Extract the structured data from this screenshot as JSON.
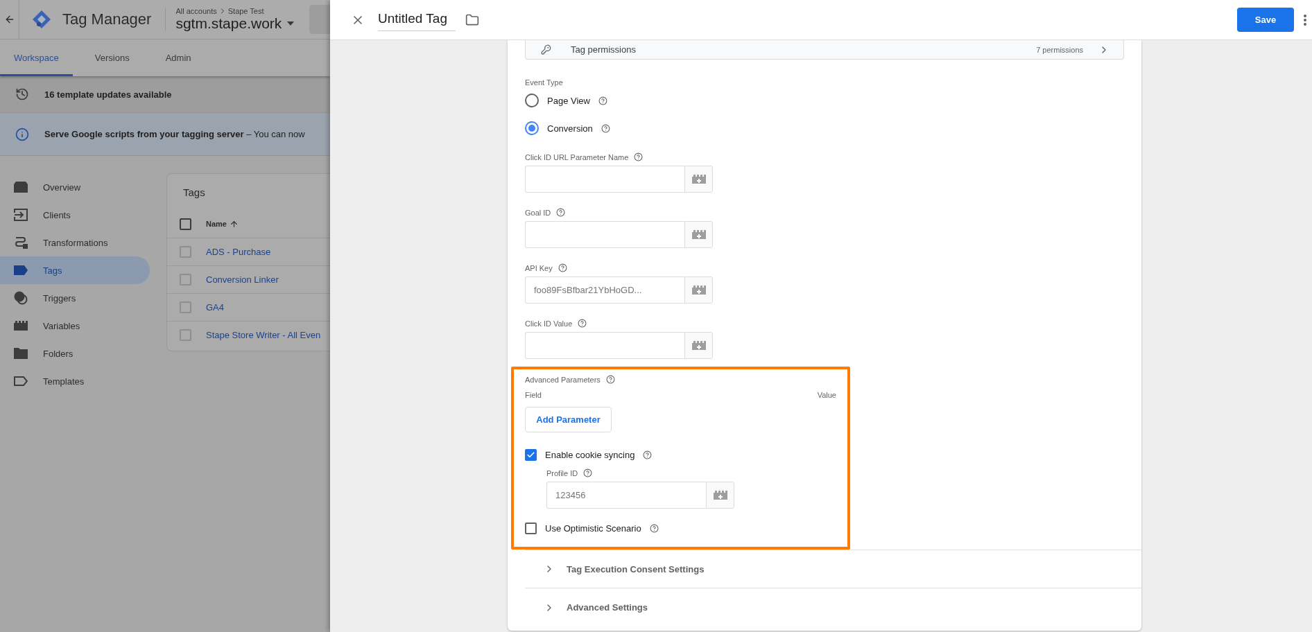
{
  "app": {
    "title": "Tag Manager",
    "breadcrumb": [
      "All accounts",
      "Stape Test"
    ],
    "container": "sgtm.stape.work"
  },
  "nav_tabs": [
    {
      "label": "Workspace",
      "selected": true
    },
    {
      "label": "Versions",
      "selected": false
    },
    {
      "label": "Admin",
      "selected": false
    }
  ],
  "notice": "16 template updates available",
  "banner": "**Serve Google scripts from your tagging server** – You can now",
  "sidebar": {
    "items": [
      {
        "label": "Overview",
        "selected": false
      },
      {
        "label": "Clients",
        "selected": false
      },
      {
        "label": "Transformations",
        "selected": false
      },
      {
        "label": "Tags",
        "selected": true
      },
      {
        "label": "Triggers",
        "selected": false
      },
      {
        "label": "Variables",
        "selected": false
      },
      {
        "label": "Folders",
        "selected": false
      },
      {
        "label": "Templates",
        "selected": false
      }
    ]
  },
  "tags_panel": {
    "title": "Tags",
    "column": "Name",
    "header_checked": false,
    "rows": [
      {
        "name": "ADS - Purchase",
        "checked": false
      },
      {
        "name": "Conversion Linker",
        "checked": false
      },
      {
        "name": "GA4",
        "checked": false
      },
      {
        "name": "Stape Store Writer - All Even",
        "checked": false
      }
    ]
  },
  "drawer": {
    "title": "Untitled Tag",
    "save": "Save"
  },
  "permissions": {
    "label": "Tag permissions",
    "count": "7 permissions"
  },
  "event_type": {
    "label": "Event Type",
    "options": [
      {
        "label": "Page View",
        "selected": false
      },
      {
        "label": "Conversion",
        "selected": true
      }
    ]
  },
  "fields": [
    {
      "label": "Click ID URL Parameter Name"
    },
    {
      "label": "Goal ID"
    },
    {
      "label": "API Key",
      "value": "foo89FsBfbar21YbHoGD..."
    },
    {
      "label": "Click ID Value"
    }
  ],
  "advanced_parameters": {
    "label": "Advanced Parameters",
    "field_header": "Field",
    "value_header": "Value",
    "add_button": "Add Parameter",
    "options": [
      {
        "label": "Enable cookie syncing",
        "checked": true,
        "sub_field": {
          "label": "Profile ID",
          "value": "123456"
        }
      },
      {
        "label": "Use Optimistic Scenario",
        "checked": false
      }
    ]
  },
  "sections": [
    {
      "label": "Tag Execution Consent Settings",
      "expanded": false
    },
    {
      "label": "Advanced Settings",
      "expanded": false
    }
  ]
}
